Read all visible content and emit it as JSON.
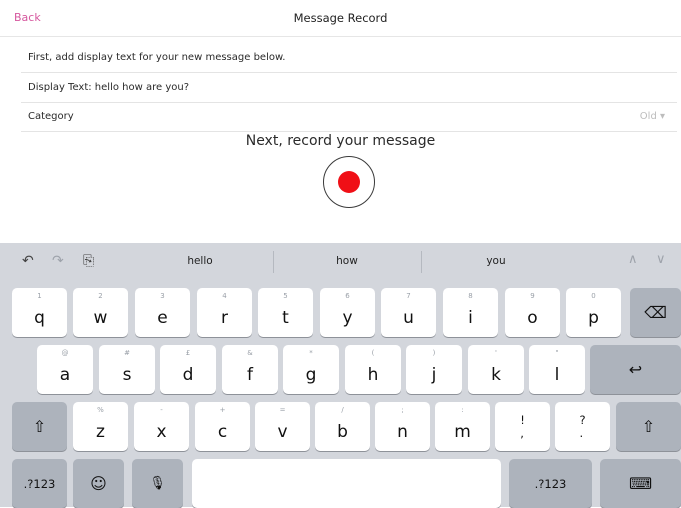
{
  "nav": {
    "back_label": "Back",
    "title": "Message Record"
  },
  "form": {
    "instruction": "First, add display text for your new message below.",
    "display_text": "Display Text: hello how are you?",
    "category_label": "Category",
    "category_value": "Old ▾"
  },
  "record": {
    "heading": "Next, record your message"
  },
  "keyboard": {
    "suggestions": [
      "hello",
      "how",
      "you"
    ],
    "row1": [
      {
        "hint": "1",
        "key": "q"
      },
      {
        "hint": "2",
        "key": "w"
      },
      {
        "hint": "3",
        "key": "e"
      },
      {
        "hint": "4",
        "key": "r"
      },
      {
        "hint": "5",
        "key": "t"
      },
      {
        "hint": "6",
        "key": "y"
      },
      {
        "hint": "7",
        "key": "u"
      },
      {
        "hint": "8",
        "key": "i"
      },
      {
        "hint": "9",
        "key": "o"
      },
      {
        "hint": "0",
        "key": "p"
      }
    ],
    "row2": [
      {
        "hint": "@",
        "key": "a"
      },
      {
        "hint": "#",
        "key": "s"
      },
      {
        "hint": "£",
        "key": "d"
      },
      {
        "hint": "&",
        "key": "f"
      },
      {
        "hint": "*",
        "key": "g"
      },
      {
        "hint": "(",
        "key": "h"
      },
      {
        "hint": ")",
        "key": "j"
      },
      {
        "hint": "'",
        "key": "k"
      },
      {
        "hint": "\"",
        "key": "l"
      }
    ],
    "row3": [
      {
        "hint": "%",
        "key": "z"
      },
      {
        "hint": "-",
        "key": "x"
      },
      {
        "hint": "+",
        "key": "c"
      },
      {
        "hint": "=",
        "key": "v"
      },
      {
        "hint": "/",
        "key": "b"
      },
      {
        "hint": ";",
        "key": "n"
      },
      {
        "hint": ":",
        "key": "m"
      },
      {
        "hint": "",
        "key": "!\n,"
      },
      {
        "hint": "",
        "key": "?\n."
      }
    ],
    "numbers_label": ".?123",
    "icons": {
      "undo": "↶",
      "redo": "↷",
      "paste": "⎘",
      "chevron_up": "∧",
      "chevron_down": "∨",
      "backspace": "⌫",
      "return": "↩",
      "shift": "⇧",
      "emoji": "☺",
      "mic": "🎙",
      "hide_keyboard": "⌨"
    }
  }
}
